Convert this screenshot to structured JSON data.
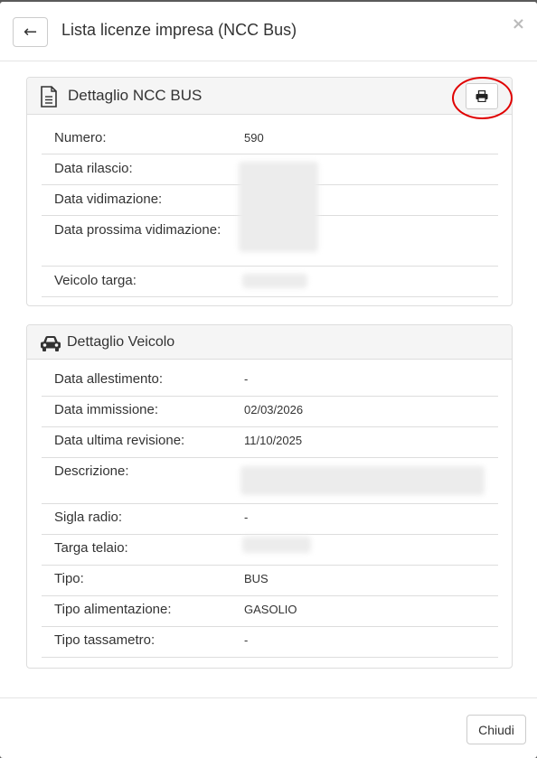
{
  "header": {
    "back_label": "←",
    "title": "Lista licenze impresa (NCC Bus)",
    "close_label": "×"
  },
  "panel_ncc": {
    "title": "Dettaglio NCC BUS",
    "icon": "document-icon",
    "print_icon": "printer-icon",
    "rows": [
      {
        "label": "Numero:",
        "value": "590"
      },
      {
        "label": "Data rilascio:",
        "value": ""
      },
      {
        "label": "Data vidimazione:",
        "value": ""
      },
      {
        "label": "Data prossima vidimazione:",
        "value": ""
      },
      {
        "label": "Veicolo targa:",
        "value": ""
      }
    ]
  },
  "panel_veicolo": {
    "title": "Dettaglio Veicolo",
    "icon": "car-icon",
    "rows": [
      {
        "label": "Data allestimento:",
        "value": "-"
      },
      {
        "label": "Data immissione:",
        "value": "02/03/2026"
      },
      {
        "label": "Data ultima revisione:",
        "value": "11/10/2025"
      },
      {
        "label": "Descrizione:",
        "value": ""
      },
      {
        "label": "Sigla radio:",
        "value": "-"
      },
      {
        "label": "Targa telaio:",
        "value": ""
      },
      {
        "label": "Tipo:",
        "value": "BUS"
      },
      {
        "label": "Tipo alimentazione:",
        "value": "GASOLIO"
      },
      {
        "label": "Tipo tassametro:",
        "value": "-"
      }
    ]
  },
  "footer": {
    "close_button_label": "Chiudi"
  },
  "colors": {
    "highlight": "#e00000",
    "panel_heading_bg": "#f5f5f5",
    "border": "#dddddd"
  }
}
